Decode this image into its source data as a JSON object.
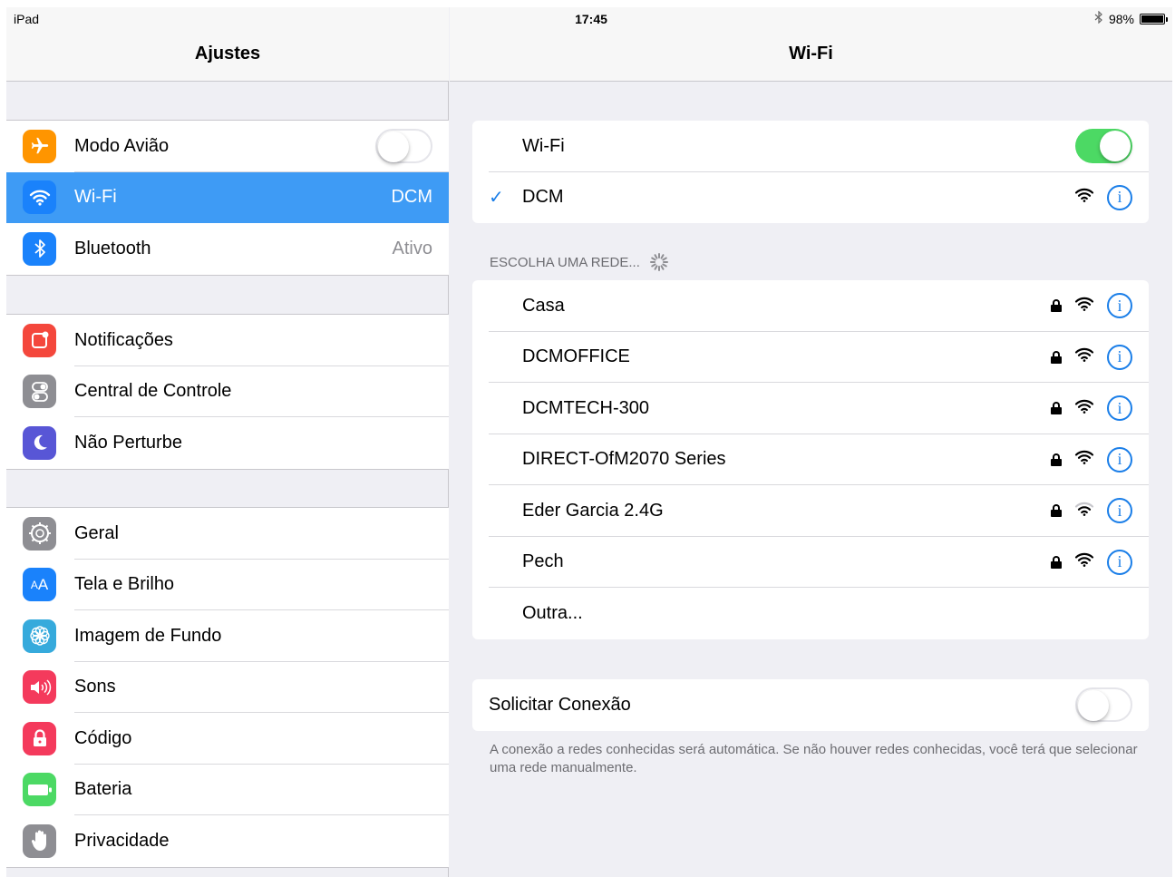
{
  "status": {
    "device": "iPad",
    "time": "17:45",
    "battery": "98%"
  },
  "master": {
    "title": "Ajustes",
    "groups": [
      [
        {
          "label": "Modo Avião",
          "icon": "airplane-icon",
          "color": "#ff9500",
          "toggle": "off"
        },
        {
          "label": "Wi-Fi",
          "icon": "wifi-icon",
          "color": "#1a82fb",
          "value": "DCM",
          "selected": true
        },
        {
          "label": "Bluetooth",
          "icon": "bluetooth-icon",
          "color": "#1a82fb",
          "value": "Ativo"
        }
      ],
      [
        {
          "label": "Notificações",
          "icon": "notifications-icon",
          "color": "#f4473c"
        },
        {
          "label": "Central de Controle",
          "icon": "control-center-icon",
          "color": "#8e8e93"
        },
        {
          "label": "Não Perturbe",
          "icon": "moon-icon",
          "color": "#5856d6"
        }
      ],
      [
        {
          "label": "Geral",
          "icon": "gear-icon",
          "color": "#8e8e93"
        },
        {
          "label": "Tela e Brilho",
          "icon": "display-brightness-icon",
          "color": "#1a82fb"
        },
        {
          "label": "Imagem de Fundo",
          "icon": "wallpaper-icon",
          "color": "#36aadc"
        },
        {
          "label": "Sons",
          "icon": "speaker-icon",
          "color": "#f43a5c"
        },
        {
          "label": "Código",
          "icon": "lock-icon",
          "color": "#f43a5c"
        },
        {
          "label": "Bateria",
          "icon": "battery-icon",
          "color": "#4cd964"
        },
        {
          "label": "Privacidade",
          "icon": "hand-icon",
          "color": "#8e8e93"
        }
      ]
    ]
  },
  "detail": {
    "title": "Wi-Fi",
    "wifi_label": "Wi-Fi",
    "wifi_toggle": "on",
    "connected_network": "DCM",
    "choose_header": "ESCOLHA UMA REDE...",
    "networks": [
      {
        "name": "Casa",
        "locked": true
      },
      {
        "name": "DCMOFFICE",
        "locked": true
      },
      {
        "name": "DCMTECH-300",
        "locked": true
      },
      {
        "name": "DIRECT-OfM2070 Series",
        "locked": true
      },
      {
        "name": "Eder Garcia 2.4G",
        "locked": true
      },
      {
        "name": "Pech",
        "locked": true
      }
    ],
    "other_label": "Outra...",
    "ask_to_join_label": "Solicitar Conexão",
    "ask_to_join_toggle": "off",
    "footer": "A conexão a redes conhecidas será automática. Se não houver redes conhecidas, você terá que selecionar uma rede manualmente."
  }
}
